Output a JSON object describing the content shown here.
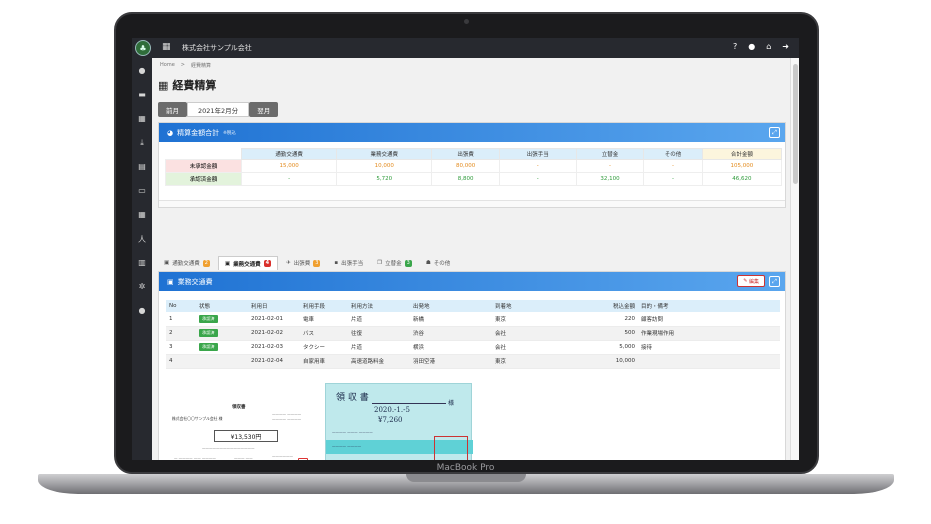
{
  "device": {
    "brand": "MacBook Pro"
  },
  "header": {
    "company": "株式会社サンプル会社"
  },
  "breadcrumb": {
    "home": "Home",
    "sep": ">",
    "current": "経費精算"
  },
  "page": {
    "title": "経費精算"
  },
  "month_nav": {
    "prev": "前月",
    "current": "2021年2月分",
    "next": "翌月"
  },
  "summary": {
    "title": "精算金額合計",
    "note": "※税込",
    "columns": [
      "通勤交通費",
      "業務交通費",
      "出張費",
      "出張手当",
      "立替金",
      "その他",
      "合計金額"
    ],
    "rows": [
      {
        "label": "未承認金額",
        "values": [
          "15,000",
          "10,000",
          "80,000",
          "-",
          "-",
          "-",
          "105,000"
        ]
      },
      {
        "label": "承認済金額",
        "values": [
          "-",
          "5,720",
          "8,800",
          "-",
          "32,100",
          "-",
          "46,620"
        ]
      }
    ]
  },
  "tabs": [
    {
      "label": "通勤交通費",
      "badge": "2",
      "badge_color": "#f0a030",
      "icon": "train-icon"
    },
    {
      "label": "業務交通費",
      "badge": "4",
      "badge_color": "#d9302c",
      "icon": "train-icon"
    },
    {
      "label": "出張費",
      "badge": "3",
      "badge_color": "#f0a030",
      "icon": "plane-icon"
    },
    {
      "label": "出張手当",
      "badge": "",
      "badge_color": "",
      "icon": "lock-icon"
    },
    {
      "label": "立替金",
      "badge": "3",
      "badge_color": "#3aa64b",
      "icon": "copy-icon"
    },
    {
      "label": "その他",
      "badge": "",
      "badge_color": "",
      "icon": "people-icon"
    }
  ],
  "detail": {
    "title": "業務交通費",
    "edit_label": "編集",
    "columns": [
      "No",
      "状態",
      "利用日",
      "利用手段",
      "利用方法",
      "出発地",
      "到着地",
      "税込金額",
      "目的・備考"
    ],
    "rows": [
      {
        "no": "1",
        "status": "承認済",
        "date": "2021-02-01",
        "means": "電車",
        "method": "片道",
        "from": "新橋",
        "to": "東京",
        "amount": "220",
        "note": "顧客訪問"
      },
      {
        "no": "2",
        "status": "承認済",
        "date": "2021-02-02",
        "means": "バス",
        "method": "往復",
        "from": "渋谷",
        "to": "会社",
        "amount": "500",
        "note": "作業現場作用"
      },
      {
        "no": "3",
        "status": "承認済",
        "date": "2021-02-03",
        "means": "タクシー",
        "method": "片道",
        "from": "横浜",
        "to": "会社",
        "amount": "5,000",
        "note": "接待"
      },
      {
        "no": "4",
        "status": "",
        "date": "2021-02-04",
        "means": "自家用車",
        "method": "高速道路料金",
        "from": "羽田空港",
        "to": "東京",
        "amount": "10,000",
        "note": ""
      }
    ]
  },
  "receipt1": {
    "title": "領収書",
    "to": "株式会社〇〇サンプル会社 様",
    "amount": "¥13,530円"
  },
  "receipt2": {
    "title": "領 収 書",
    "date": "2020.-1.-5",
    "suffix": "様",
    "amount": "¥7,260"
  }
}
